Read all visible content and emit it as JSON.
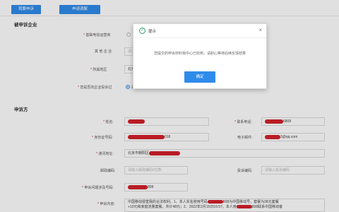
{
  "toolbar": {
    "btn_left": "我要申诉",
    "btn_right": "申请调解"
  },
  "section1": {
    "title": "被申诉企业",
    "fields": {
      "operator_label": "基础电信运营商",
      "other_label": "其 他 企 业",
      "other_value": "请选",
      "region_label": "所属地区",
      "region_value": "北京",
      "complained_label": "您是否向企业投诉过",
      "complained_value": "是"
    }
  },
  "section2": {
    "title": "申诉方",
    "name_label": "姓名:",
    "contact_phone_label": "联系电话:",
    "contact_phone_suffix": "6808",
    "id_label": "身份证号码:",
    "id_suffix": "018",
    "email_label": "电子邮件:",
    "email_suffix": "3@qq.com",
    "address_label": "通讯地址:",
    "address_prefix": "北京市朝阳区",
    "postcode_label": "邮政编码:",
    "postcode_placeholder": "请输入邮政编码6位数",
    "mobile_label": "投诉编码:",
    "mobile_placeholder": "请输入投诉编码",
    "issue_number_label": "申诉问题涉及号码:",
    "issue_number_suffix": "808",
    "content_label": "申诉内容:",
    "content_line1": "中国移动侵害我的合法权利。1、本人实名使用号码",
    "content_line1b": "808为中国移动号，套餐为38元套餐",
    "content_line2": "+10元和家庭流量套餐，共计48元；2、2022年2月15日16:57，本人用",
    "content_line2b": "808联系中国移动客"
  },
  "dialog": {
    "title": "提示",
    "close": "×",
    "icon_glyph": "✓",
    "message": "您提交的申诉材料我中心已收到，请耐心等待后续反馈结果",
    "ok_label": "确定"
  },
  "colors": {
    "accent": "#2f8bea",
    "redaction": "#d3202b",
    "required": "#e02020",
    "success": "#2fa36b"
  }
}
